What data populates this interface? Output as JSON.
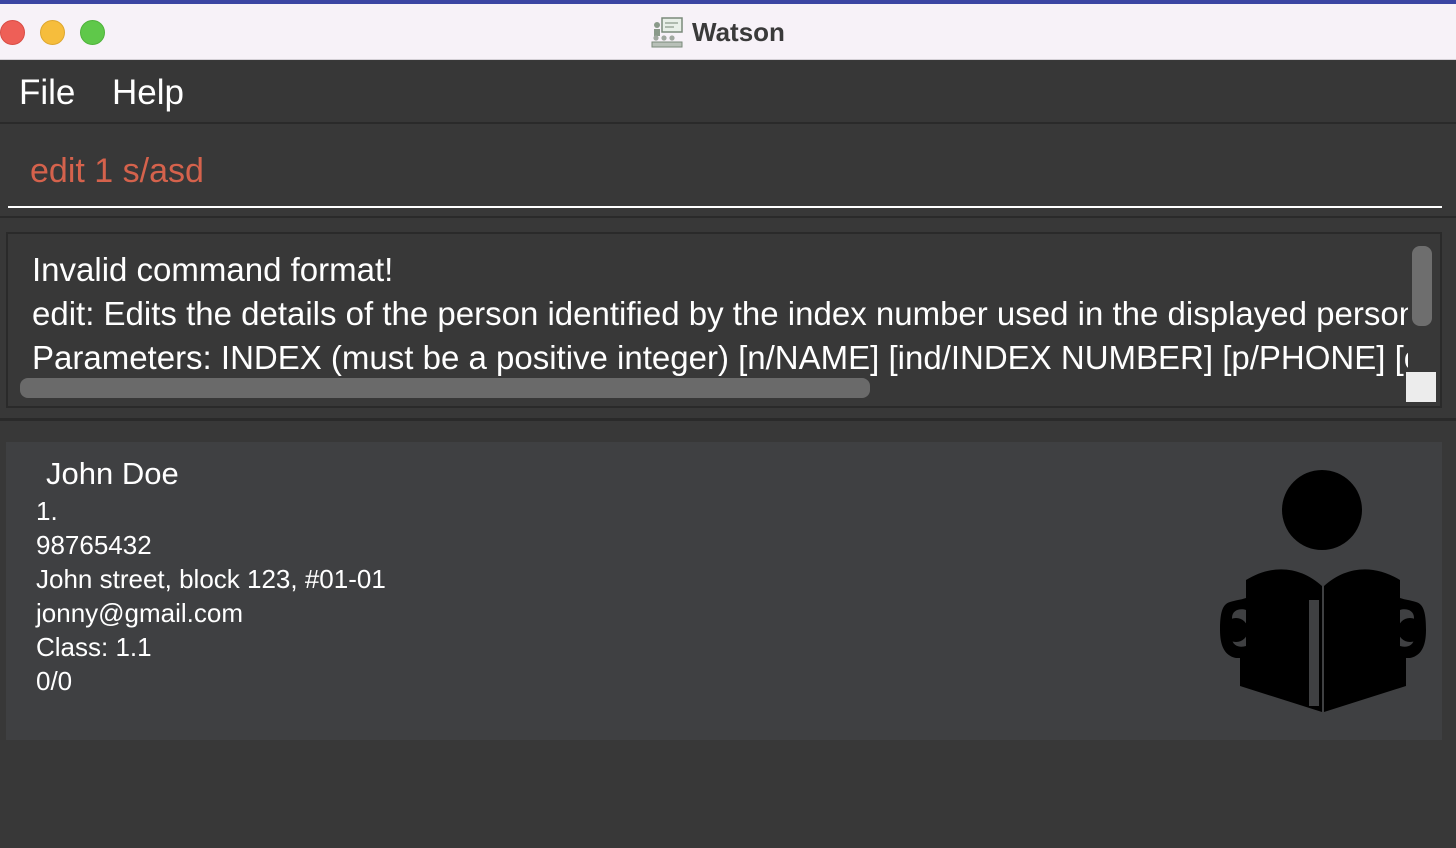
{
  "window": {
    "title": "Watson",
    "app_icon": "classroom-icon",
    "accent_color": "#3b46a3"
  },
  "menu": {
    "file_label": "File",
    "help_label": "Help"
  },
  "command": {
    "value": "edit 1 s/asd",
    "text_color": "#d5624c"
  },
  "result": {
    "lines": [
      "Invalid command format!",
      "edit: Edits the details of the person identified by the index number used in the displayed person li",
      "Parameters: INDEX (must be a positive integer) [n/NAME] [ind/INDEX NUMBER] [p/PHONE] [e/I"
    ]
  },
  "person": {
    "name": "John Doe",
    "index": "1.",
    "phone": "98765432",
    "address": "John street, block 123, #01-01",
    "email": "jonny@gmail.com",
    "class": "Class: 1.1",
    "score": "0/0",
    "icon": "student-reading-icon"
  }
}
